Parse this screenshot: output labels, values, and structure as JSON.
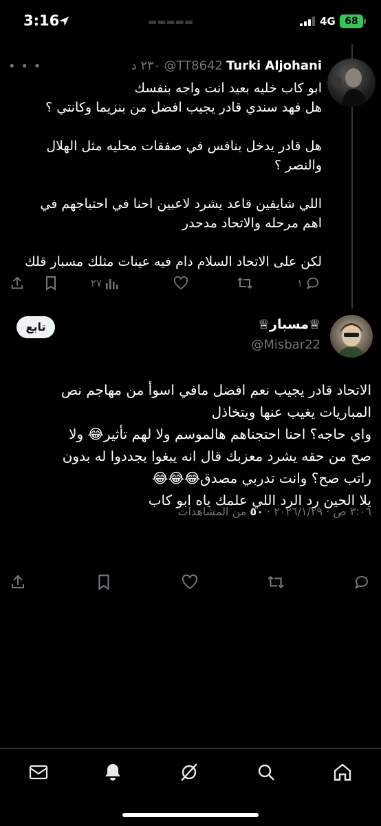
{
  "status_bar": {
    "time": "3:16",
    "network": "4G",
    "battery": "68"
  },
  "tweet1": {
    "name": "Turki Aljohani",
    "handle": "@TT8642",
    "time": "٢٣٠ د",
    "lines": [
      "ابو كاب خليه بعيد انت واجه بنفسك",
      "هل فهد سندي قادر يجيب افضل من بنزيما وكانتي ؟",
      "",
      "هل قادر يدخل ينافس في صفقات محليه مثل الهلال",
      "والنصر ؟",
      "",
      "اللي شايفين قاعد يشرد لاعبين احنا في احتياجهم في",
      "اهم مرحله والاتحاد مدحدر",
      "",
      "لكن على الاتحاد السلام دام فيه عينات مثلك مسبار قلك"
    ],
    "replies": "١",
    "views": "٢٧"
  },
  "tweet2": {
    "name": "♕مسبار♕",
    "handle": "@Misbar22",
    "follow_label": "تابع",
    "lines": [
      "الاتحاد قادر يجيب نعم افضل مافي اسوأ من مهاجم نص",
      "المباريات يغيب عنها ويتخاذل",
      "واي حاجه؟ احنا احتجناهم هالموسم ولا لهم تأثير😂 ولا",
      "صح من حقه يشرد معزبك قال انه يبغوا يجددوا له بدون",
      "راتب صح؟ وانت تدربي مصدق😂😂😂",
      "يلا الحين رد الرد اللي علمك ياه ابو كاب"
    ],
    "meta_prefix": "٣:٠٦ ص · ٢٠٢٦/١/٢٩ · ",
    "views_count": "٥٠",
    "views_label": " من المشاهدات"
  },
  "icons": {
    "share": "share-icon",
    "bookmark": "bookmark-icon",
    "views": "views-icon",
    "like": "heart-icon",
    "retweet": "retweet-icon",
    "reply": "reply-icon"
  }
}
